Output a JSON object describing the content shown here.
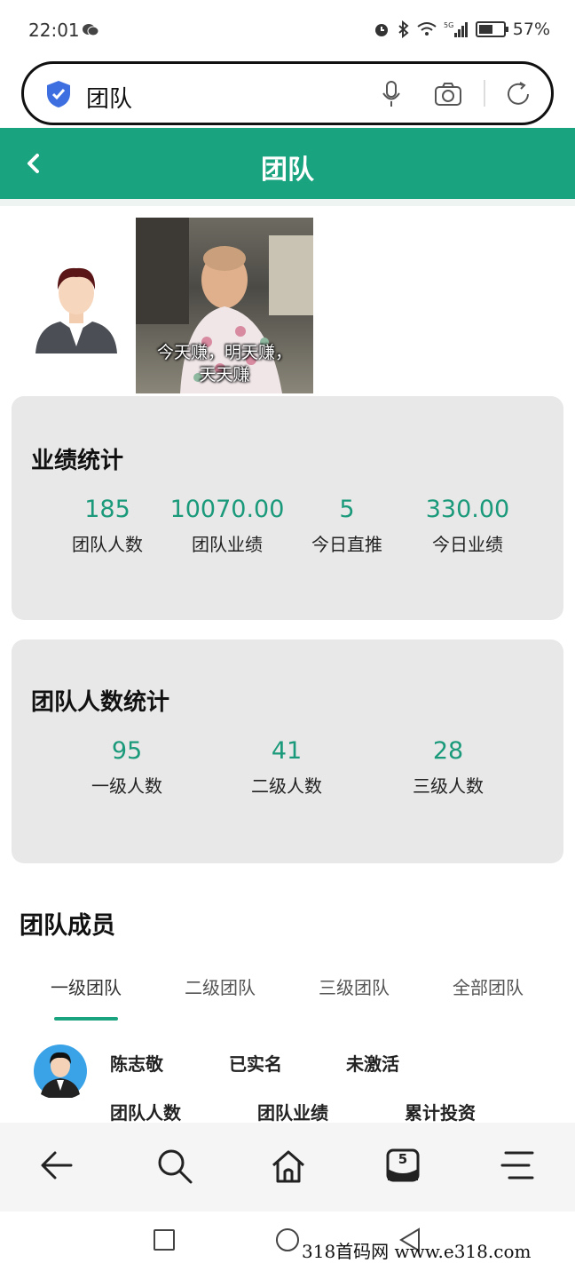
{
  "status_bar": {
    "time": "22:01",
    "battery_pct": 57,
    "battery_text": "57%"
  },
  "search": {
    "query": "团队"
  },
  "header": {
    "title": "团队"
  },
  "meme": {
    "caption_line1": "今天赚，明天赚，",
    "caption_line2": "天天赚"
  },
  "performance": {
    "title": "业绩统计",
    "stats": [
      {
        "value": "185",
        "label": "团队人数"
      },
      {
        "value": "10070.00",
        "label": "团队业绩"
      },
      {
        "value": "5",
        "label": "今日直推"
      },
      {
        "value": "330.00",
        "label": "今日业绩"
      }
    ]
  },
  "team_count": {
    "title": "团队人数统计",
    "stats": [
      {
        "value": "95",
        "label": "一级人数"
      },
      {
        "value": "41",
        "label": "二级人数"
      },
      {
        "value": "28",
        "label": "三级人数"
      }
    ]
  },
  "members": {
    "title": "团队成员",
    "tabs": [
      "一级团队",
      "二级团队",
      "三级团队",
      "全部团队"
    ],
    "active_tab": 0,
    "first": {
      "name": "陈志敬",
      "verified": "已实名",
      "status": "未激活",
      "col1": "团队人数",
      "col2": "团队业绩",
      "col3": "累计投资"
    }
  },
  "bottom_nav": {
    "tabs_count": "5"
  },
  "watermark": "318首码网 www.e318.com",
  "colors": {
    "accent": "#19a37f",
    "value_green": "#1a9a7a",
    "card_bg": "#e8e8e8"
  }
}
